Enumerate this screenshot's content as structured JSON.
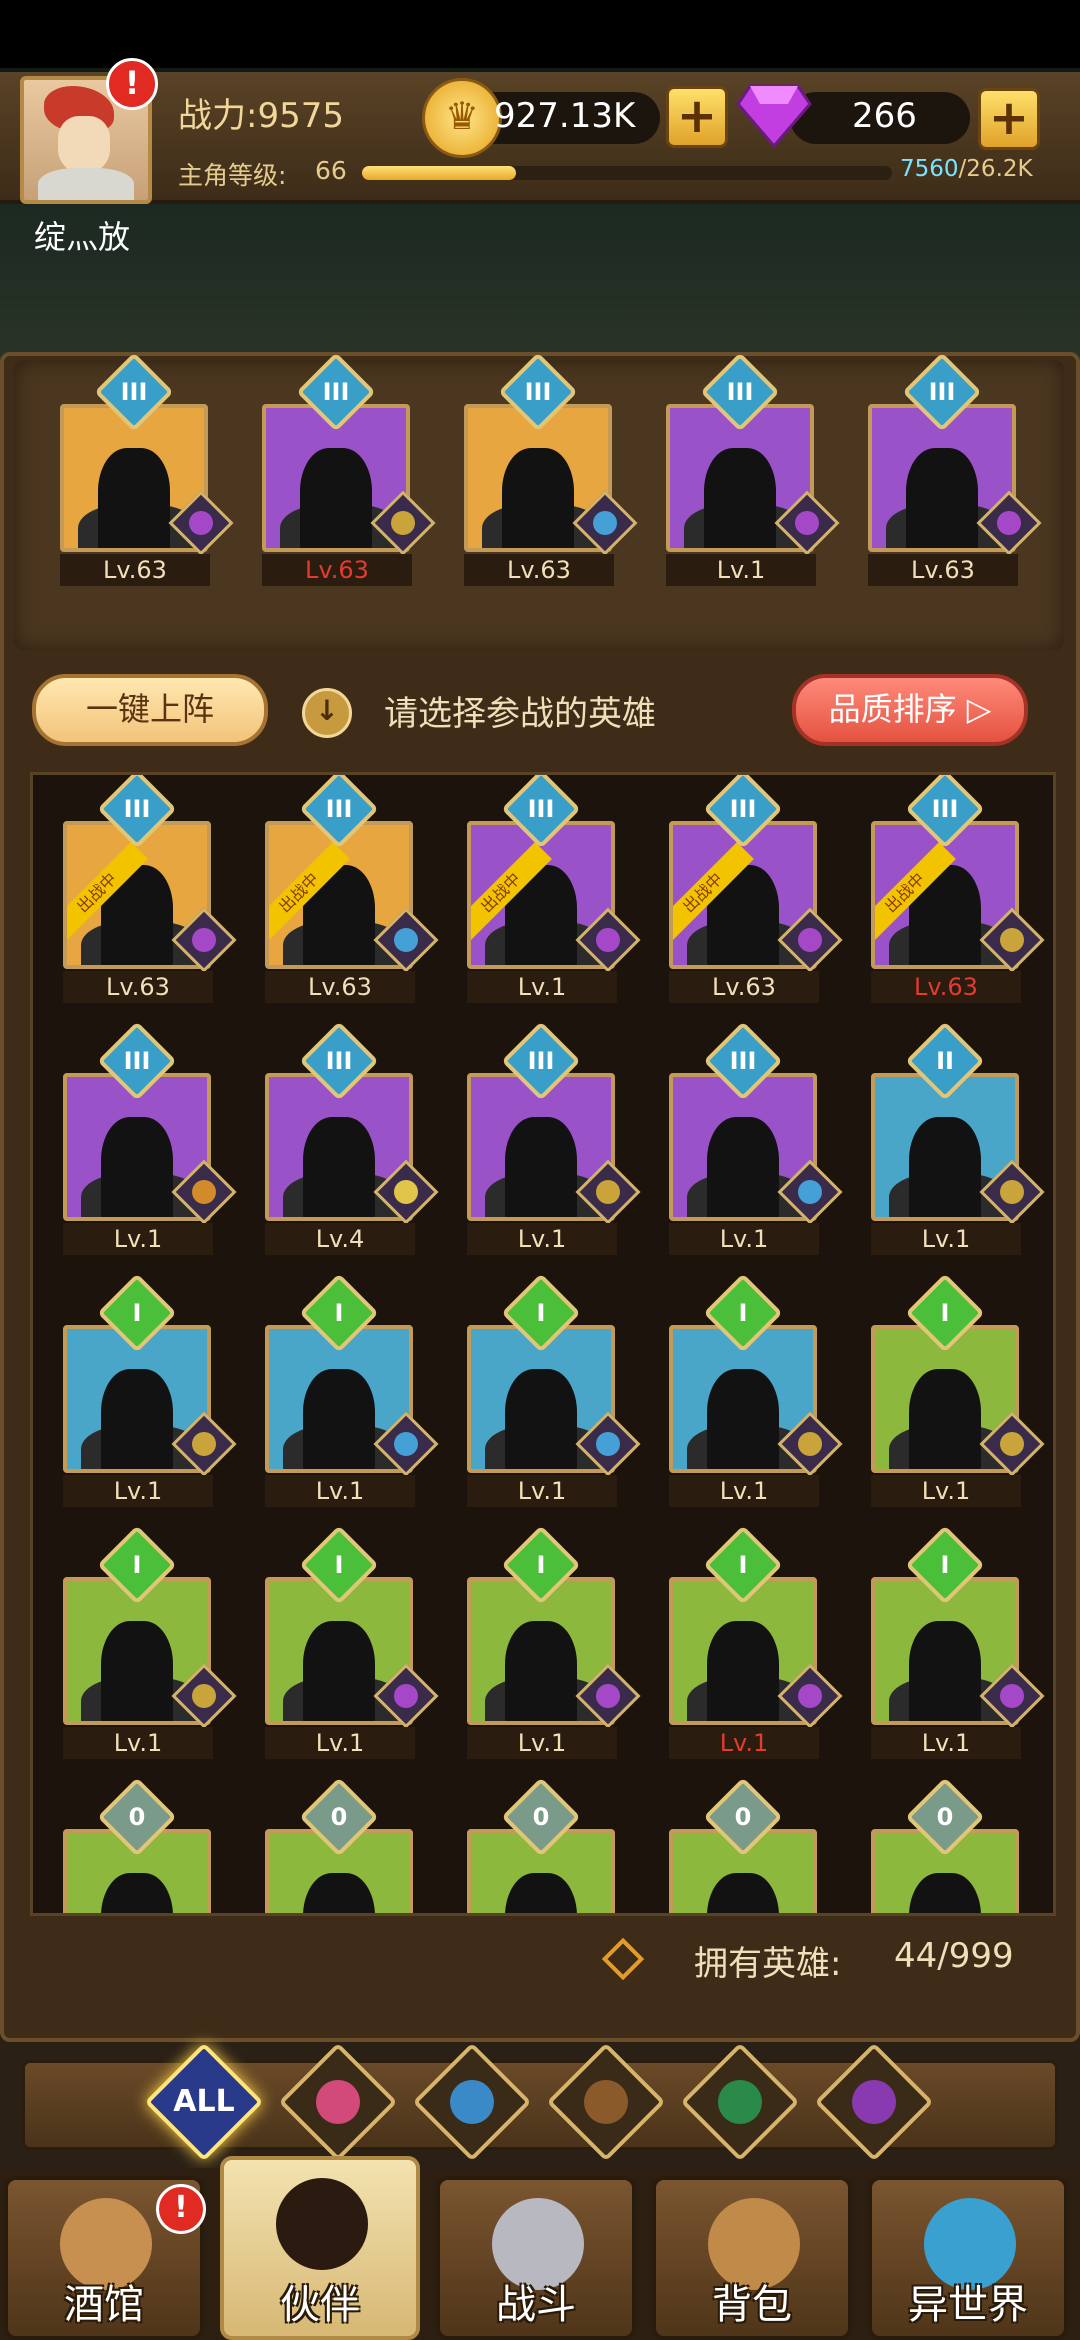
{
  "player": {
    "name": "绽灬放",
    "power_label": "战力:9575",
    "level_label": "主角等级:",
    "level": "66",
    "xp_current": "7560",
    "xp_max": "/26.2K",
    "xp_fraction": 0.29
  },
  "currency": {
    "gold": "927.13K",
    "gems": "266",
    "plus_symbol": "+"
  },
  "lineup": [
    {
      "level": "Lv.63",
      "rank": "III",
      "bg": "#e8a640",
      "faction_color": "#a548c8",
      "red": false
    },
    {
      "level": "Lv.63",
      "rank": "III",
      "bg": "#9a52c8",
      "faction_color": "#c8a43a",
      "red": true
    },
    {
      "level": "Lv.63",
      "rank": "III",
      "bg": "#e8a640",
      "faction_color": "#45a0d8",
      "red": false
    },
    {
      "level": "Lv.1",
      "rank": "III",
      "bg": "#9a52c8",
      "faction_color": "#a548c8",
      "red": false
    },
    {
      "level": "Lv.63",
      "rank": "III",
      "bg": "#9a52c8",
      "faction_color": "#a548c8",
      "red": false
    }
  ],
  "controls": {
    "one_key_label": "一键上阵",
    "info_icon": "↓",
    "prompt": "请选择参战的英雄",
    "sort_label": "品质排序 ▷"
  },
  "in_battle_ribbon": "出战中",
  "heroes": [
    {
      "level": "Lv.63",
      "rank": "III",
      "bg": "#e8a640",
      "faction_color": "#a548c8",
      "red": false,
      "in_battle": true
    },
    {
      "level": "Lv.63",
      "rank": "III",
      "bg": "#e8a640",
      "faction_color": "#45a0d8",
      "red": false,
      "in_battle": true
    },
    {
      "level": "Lv.1",
      "rank": "III",
      "bg": "#9a52c8",
      "faction_color": "#a548c8",
      "red": false,
      "in_battle": true
    },
    {
      "level": "Lv.63",
      "rank": "III",
      "bg": "#9a52c8",
      "faction_color": "#a548c8",
      "red": false,
      "in_battle": true
    },
    {
      "level": "Lv.63",
      "rank": "III",
      "bg": "#9a52c8",
      "faction_color": "#c8a43a",
      "red": true,
      "in_battle": true
    },
    {
      "level": "Lv.1",
      "rank": "III",
      "bg": "#9a52c8",
      "faction_color": "#d28a2a",
      "red": false,
      "in_battle": false
    },
    {
      "level": "Lv.4",
      "rank": "III",
      "bg": "#9a52c8",
      "faction_color": "#e1c44a",
      "red": false,
      "in_battle": false
    },
    {
      "level": "Lv.1",
      "rank": "III",
      "bg": "#9a52c8",
      "faction_color": "#c8a43a",
      "red": false,
      "in_battle": false
    },
    {
      "level": "Lv.1",
      "rank": "III",
      "bg": "#9a52c8",
      "faction_color": "#45a0d8",
      "red": false,
      "in_battle": false
    },
    {
      "level": "Lv.1",
      "rank": "II",
      "bg": "#49a6c8",
      "faction_color": "#c8a43a",
      "red": false,
      "in_battle": false
    },
    {
      "level": "Lv.1",
      "rank": "I",
      "bg": "#49a6c8",
      "faction_color": "#c8a43a",
      "red": false,
      "in_battle": false
    },
    {
      "level": "Lv.1",
      "rank": "I",
      "bg": "#49a6c8",
      "faction_color": "#45a0d8",
      "red": false,
      "in_battle": false
    },
    {
      "level": "Lv.1",
      "rank": "I",
      "bg": "#49a6c8",
      "faction_color": "#45a0d8",
      "red": false,
      "in_battle": false
    },
    {
      "level": "Lv.1",
      "rank": "I",
      "bg": "#49a6c8",
      "faction_color": "#c8a43a",
      "red": false,
      "in_battle": false
    },
    {
      "level": "Lv.1",
      "rank": "I",
      "bg": "#8cb83e",
      "faction_color": "#c8a43a",
      "red": false,
      "in_battle": false
    },
    {
      "level": "Lv.1",
      "rank": "I",
      "bg": "#8cb83e",
      "faction_color": "#c8a43a",
      "red": false,
      "in_battle": false
    },
    {
      "level": "Lv.1",
      "rank": "I",
      "bg": "#8cb83e",
      "faction_color": "#a548c8",
      "red": false,
      "in_battle": false
    },
    {
      "level": "Lv.1",
      "rank": "I",
      "bg": "#8cb83e",
      "faction_color": "#a548c8",
      "red": false,
      "in_battle": false
    },
    {
      "level": "Lv.1",
      "rank": "I",
      "bg": "#8cb83e",
      "faction_color": "#a548c8",
      "red": true,
      "in_battle": false
    },
    {
      "level": "Lv.1",
      "rank": "I",
      "bg": "#8cb83e",
      "faction_color": "#a548c8",
      "red": false,
      "in_battle": false
    },
    {
      "level": "",
      "rank": "0",
      "bg": "#8cb83e",
      "faction_color": "#a548c8",
      "red": false,
      "in_battle": false
    },
    {
      "level": "",
      "rank": "0",
      "bg": "#8cb83e",
      "faction_color": "#a548c8",
      "red": false,
      "in_battle": false
    },
    {
      "level": "",
      "rank": "0",
      "bg": "#8cb83e",
      "faction_color": "#a548c8",
      "red": false,
      "in_battle": false
    },
    {
      "level": "",
      "rank": "0",
      "bg": "#8cb83e",
      "faction_color": "#a548c8",
      "red": false,
      "in_battle": false
    },
    {
      "level": "",
      "rank": "0",
      "bg": "#8cb83e",
      "faction_color": "#a548c8",
      "red": false,
      "in_battle": false
    }
  ],
  "owned": {
    "label": "拥有英雄:",
    "value": "44/999"
  },
  "filters": [
    {
      "name": "all",
      "label": "ALL",
      "color": "#2a3a8a"
    },
    {
      "name": "knight",
      "label": "",
      "color": "#d24a7a"
    },
    {
      "name": "fish",
      "label": "",
      "color": "#3a8ac8"
    },
    {
      "name": "lion",
      "label": "",
      "color": "#8a5a2a"
    },
    {
      "name": "elf",
      "label": "",
      "color": "#2a8a4a"
    },
    {
      "name": "demon",
      "label": "",
      "color": "#8a3ab0"
    }
  ],
  "tabs": [
    {
      "name": "tavern",
      "label": "酒馆",
      "icon_color": "#c89050",
      "active": false
    },
    {
      "name": "partner",
      "label": "伙伴",
      "icon_color": "#2a1a10",
      "active": true
    },
    {
      "name": "battle",
      "label": "战斗",
      "icon_color": "#b8b8c0",
      "active": false
    },
    {
      "name": "bag",
      "label": "背包",
      "icon_color": "#c08a48",
      "active": false
    },
    {
      "name": "other-world",
      "label": "异世界",
      "icon_color": "#3aa0d0",
      "active": false
    }
  ],
  "alert_symbol": "!"
}
